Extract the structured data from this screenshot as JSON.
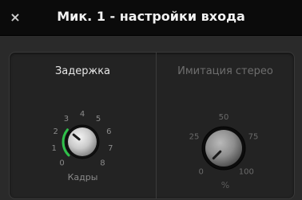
{
  "window": {
    "title": "Мик. 1 - настройки входа",
    "close_glyph": "×"
  },
  "delay": {
    "label": "Задержка",
    "unit": "Кадры",
    "ticks": [
      "0",
      "1",
      "2",
      "3",
      "4",
      "5",
      "6",
      "7",
      "8"
    ],
    "value": 2.5,
    "min": 0,
    "max": 8,
    "accent_color": "#2fc14a"
  },
  "stereo": {
    "label": "Имитация стерео",
    "unit": "%",
    "ticks": [
      "0",
      "25",
      "50",
      "75",
      "100"
    ],
    "value": 0,
    "min": 0,
    "max": 100,
    "enabled": false
  }
}
